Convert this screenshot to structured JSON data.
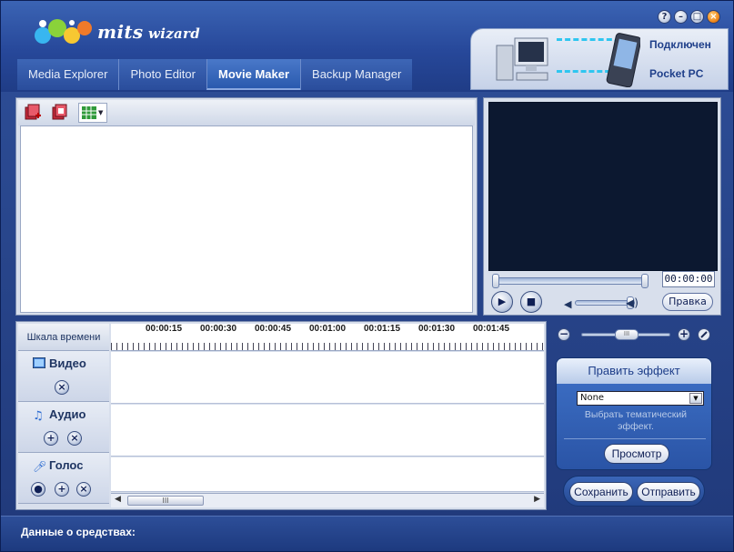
{
  "app": {
    "logo_text_big": "mits",
    "logo_text_small": "wizard"
  },
  "window_buttons": [
    {
      "name": "help",
      "glyph": "?"
    },
    {
      "name": "minimize",
      "glyph": "–"
    },
    {
      "name": "maximize",
      "glyph": "□"
    },
    {
      "name": "close",
      "glyph": "×"
    }
  ],
  "tabs": [
    "Media Explorer",
    "Photo Editor",
    "Movie Maker",
    "Backup Manager"
  ],
  "active_tab": "Movie Maker",
  "connection": {
    "status": "Подключен",
    "device": "Pocket PC"
  },
  "preview": {
    "timecode": "00:00:00",
    "play_glyph": "▶",
    "stop_glyph": "■",
    "edit_label": "Правка",
    "seek_progress": 0.0,
    "volume_level": 0.9
  },
  "timeline": {
    "label": "Шкала времени",
    "ticks": [
      "00:00:15",
      "00:00:30",
      "00:00:45",
      "00:01:00",
      "00:01:15",
      "00:01:30",
      "00:01:45"
    ],
    "tracks": [
      {
        "name": "Видео",
        "buttons": [
          "×"
        ]
      },
      {
        "name": "Аудио",
        "buttons": [
          "+",
          "×"
        ]
      },
      {
        "name": "Голос",
        "buttons": [
          "●",
          "+",
          "×"
        ]
      }
    ],
    "scroll_thumb": "III"
  },
  "effects": {
    "title": "Править эффект",
    "selected": "None",
    "hint": "Выбрать тематический эффект.",
    "preview_label": "Просмотр",
    "zoom_minus": "−",
    "zoom_plus": "+",
    "zoom_thumb": "III"
  },
  "actions": {
    "save": "Сохранить",
    "send": "Отправить"
  },
  "status": {
    "label": "Данные о средствах:"
  }
}
